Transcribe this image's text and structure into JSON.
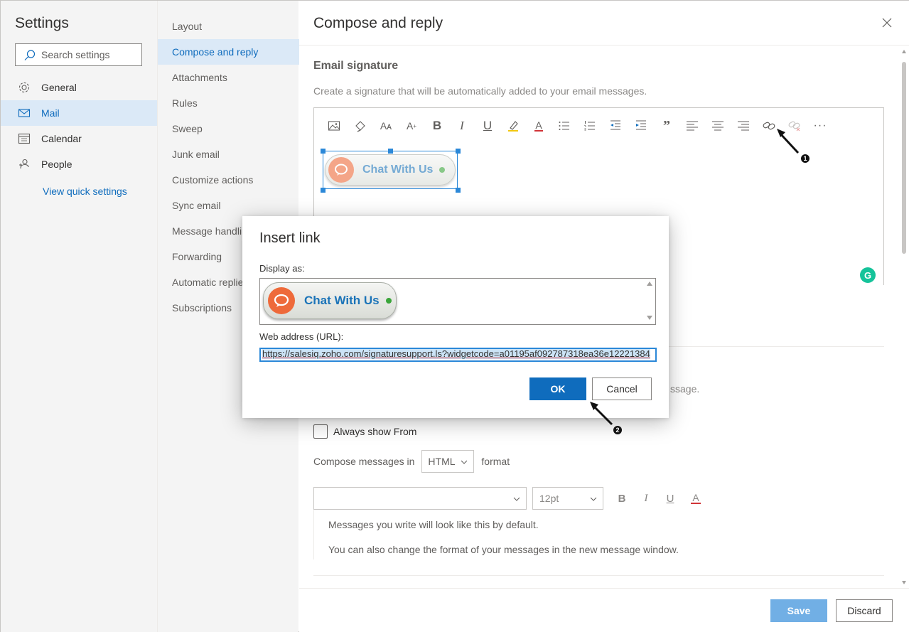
{
  "app": {
    "settings_title": "Settings",
    "search_placeholder": "Search settings"
  },
  "sidebar": {
    "items": [
      {
        "label": "General",
        "icon": "gear-icon"
      },
      {
        "label": "Mail",
        "icon": "mail-icon",
        "active": true
      },
      {
        "label": "Calendar",
        "icon": "calendar-icon"
      },
      {
        "label": "People",
        "icon": "people-icon"
      }
    ],
    "quick_settings": "View quick settings"
  },
  "subnav": {
    "items": [
      "Layout",
      "Compose and reply",
      "Attachments",
      "Rules",
      "Sweep",
      "Junk email",
      "Customize actions",
      "Sync email",
      "Message handling",
      "Forwarding",
      "Automatic replies",
      "Subscriptions"
    ],
    "active": "Compose and reply"
  },
  "panel": {
    "title": "Compose and reply",
    "section_title": "Email signature",
    "section_desc": "Create a signature that will be automatically added to your email messages.",
    "behind_text": "ssage.",
    "always_show_from": "Always show From",
    "compose_in": "Compose messages in",
    "format_value": "HTML",
    "format_suffix": "format",
    "font_size": "12pt",
    "preview_line1": "Messages you write will look like this by default.",
    "preview_line2": "You can also change the format of your messages in the new message window.",
    "save": "Save",
    "discard": "Discard"
  },
  "signature": {
    "chat_label": "Chat With Us"
  },
  "dialog": {
    "title": "Insert link",
    "display_label": "Display as:",
    "display_chat_label": "Chat With Us",
    "url_label": "Web address (URL):",
    "url_value": "https://salesiq.zoho.com/signaturesupport.ls?widgetcode=a01195af092787318ea36e12221384",
    "ok": "OK",
    "cancel": "Cancel"
  },
  "annotations": {
    "step1": "1",
    "step2": "2"
  },
  "colors": {
    "accent": "#0f6cbd",
    "nav_active_bg": "#dbe9f7",
    "save_disabled": "#71afe5",
    "chat_orange": "#ee6a3a",
    "chat_blue": "#1a73b8",
    "online_green": "#3aa53a"
  }
}
